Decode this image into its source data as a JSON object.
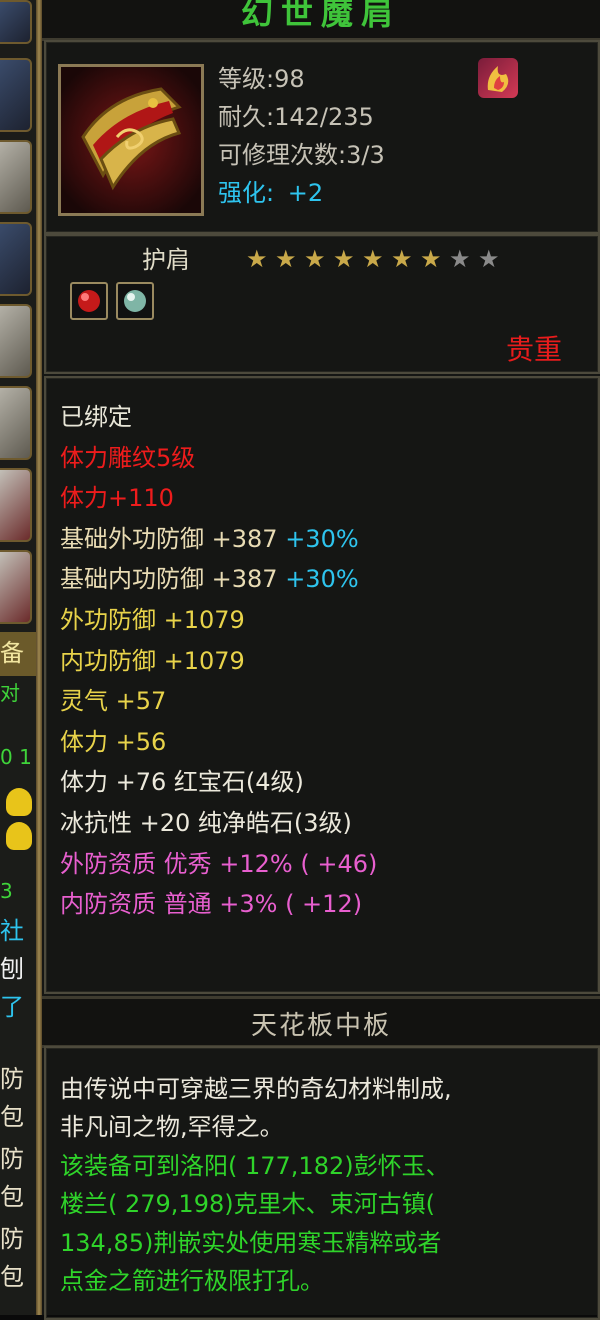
{
  "left_strip": {
    "fragments": [
      "备",
      "对",
      "0  1",
      "3",
      "社",
      "刨",
      "了",
      "防",
      "包",
      "防",
      "包",
      "防",
      "包"
    ]
  },
  "item": {
    "name": "幻世魔肩",
    "level": "等级:98",
    "durability": "耐久:142/235",
    "repairs": "可修理次数:3/3",
    "enhance_label": "强化:",
    "enhance_value": "+2"
  },
  "slot": {
    "type_label": "护肩",
    "stars_filled": 7,
    "stars_total": 9,
    "precious_label": "贵重"
  },
  "stats": [
    {
      "segments": [
        {
          "text": "已绑定",
          "color": "#e8e6d8"
        }
      ]
    },
    {
      "segments": [
        {
          "text": "体力雕纹5级",
          "color": "#ee1c1c"
        }
      ]
    },
    {
      "segments": [
        {
          "text": "体力+110",
          "color": "#ee1c1c"
        }
      ]
    },
    {
      "segments": [
        {
          "text": "基础外功防御  +387 ",
          "color": "#e9dcb4"
        },
        {
          "text": "+30%",
          "color": "#2ec4ee"
        }
      ]
    },
    {
      "segments": [
        {
          "text": "基础内功防御  +387 ",
          "color": "#e9dcb4"
        },
        {
          "text": "+30%",
          "color": "#2ec4ee"
        }
      ]
    },
    {
      "segments": [
        {
          "text": "外功防御  +1079",
          "color": "#e8d34a"
        }
      ]
    },
    {
      "segments": [
        {
          "text": "内功防御  +1079",
          "color": "#e8d34a"
        }
      ]
    },
    {
      "segments": [
        {
          "text": "灵气  +57",
          "color": "#e8d34a"
        }
      ]
    },
    {
      "segments": [
        {
          "text": "体力  +56",
          "color": "#e8d34a"
        }
      ]
    },
    {
      "segments": [
        {
          "text": "体力  +76  红宝石(4级)",
          "color": "#ece9dc"
        }
      ]
    },
    {
      "segments": [
        {
          "text": "冰抗性  +20  纯净皓石(3级)",
          "color": "#ece9dc"
        }
      ]
    },
    {
      "segments": [
        {
          "text": "外防资质   优秀  +12% ( +46)",
          "color": "#e85fcf"
        }
      ]
    },
    {
      "segments": [
        {
          "text": "内防资质   普通  +3% ( +12)",
          "color": "#e85fcf"
        }
      ]
    }
  ],
  "source": {
    "title": "天花板中板"
  },
  "description": [
    {
      "text": "由传说中可穿越三界的奇幻材料制成,",
      "color": "#ebe8dc"
    },
    {
      "text": "非凡间之物,罕得之。",
      "color": "#ebe8dc"
    },
    {
      "text": "该装备可到洛阳( 177,182)彭怀玉、",
      "color": "#2fd42a"
    },
    {
      "text": "楼兰( 279,198)克里木、束河古镇(",
      "color": "#2fd42a"
    },
    {
      "text": "134,85)荆嵌实处使用寒玉精粹或者",
      "color": "#2fd42a"
    },
    {
      "text": "点金之箭进行极限打孔。",
      "color": "#2fd42a"
    }
  ],
  "icons": {
    "item_icon": "shoulder-pad-icon",
    "badge": "flame-emblem-icon",
    "sockets": [
      "ruby-gem-icon",
      "pure-stone-gem-icon"
    ]
  },
  "colors": {
    "title": "#3fc43a",
    "enhance": "#2ec4ee",
    "precious": "#e81c1c",
    "star_on": "#c9a94a",
    "star_off": "#8a8a8a"
  }
}
